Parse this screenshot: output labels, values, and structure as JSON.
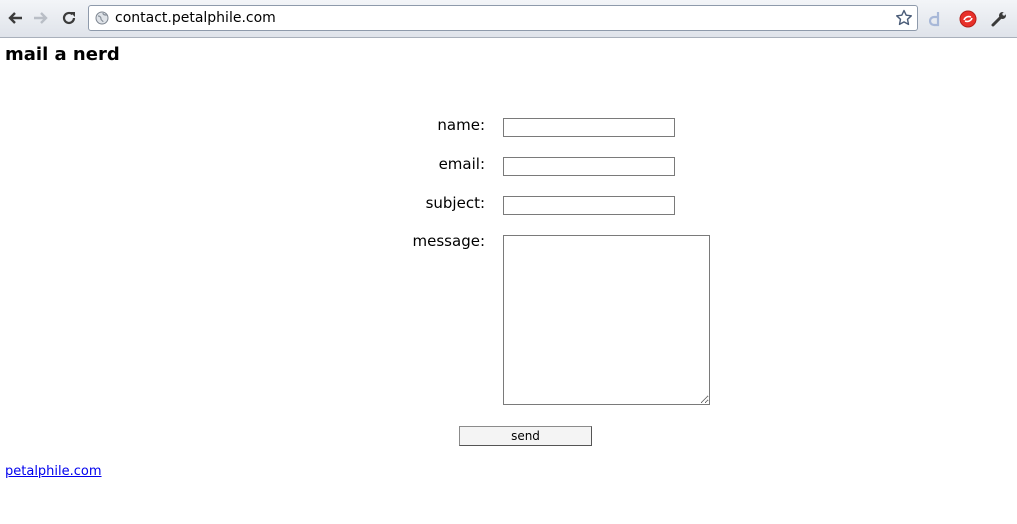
{
  "browser": {
    "url": "contact.petalphile.com"
  },
  "page": {
    "title": "mail a nerd",
    "form": {
      "name_label": "name:",
      "email_label": "email:",
      "subject_label": "subject:",
      "message_label": "message:",
      "name_value": "",
      "email_value": "",
      "subject_value": "",
      "message_value": "",
      "send_label": "send"
    },
    "footer_link": "petalphile.com"
  },
  "colors": {
    "link": "#0000ee",
    "chrome_bg": "#dfe3ea",
    "ext_red": "#e8302a"
  },
  "icons": [
    "back-arrow-icon",
    "forward-arrow-icon",
    "reload-icon",
    "globe-icon",
    "star-icon",
    "delicious-extension-icon",
    "red-extension-icon",
    "wrench-icon"
  ]
}
